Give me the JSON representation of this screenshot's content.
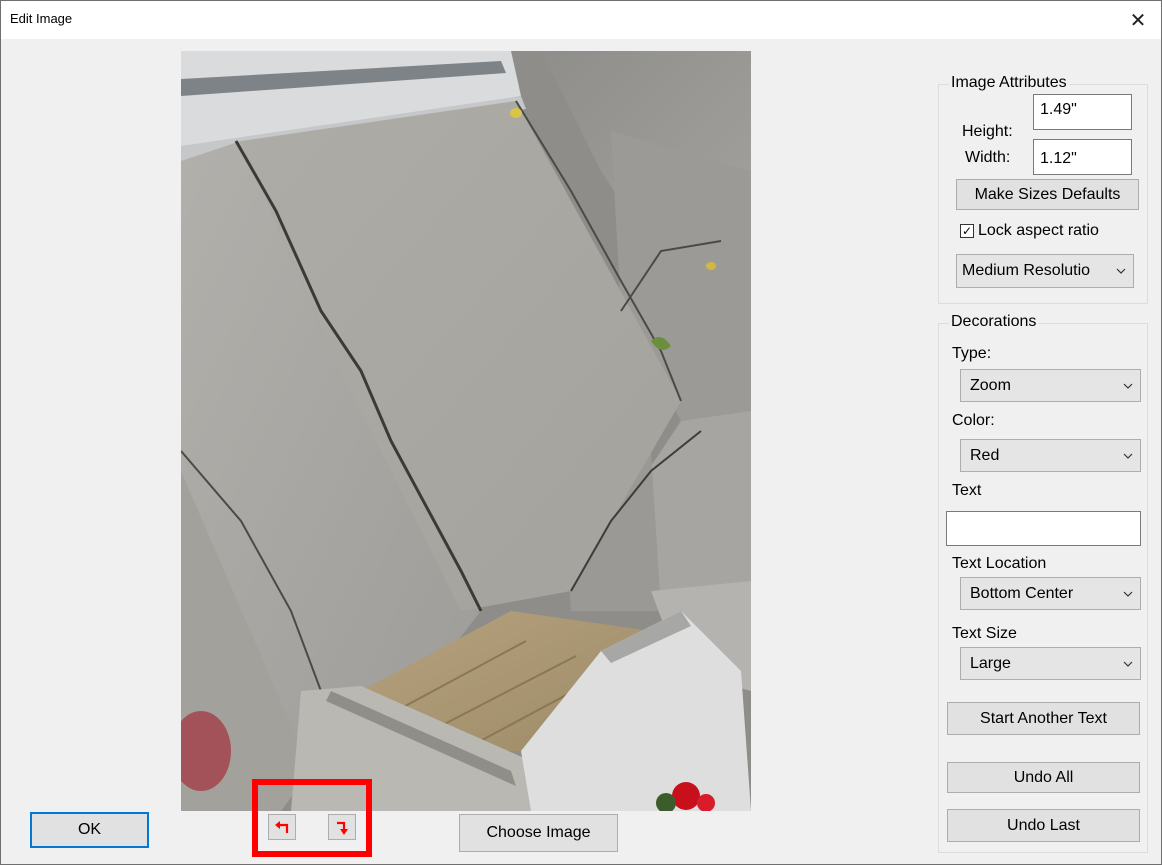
{
  "window": {
    "title": "Edit Image",
    "close_label": "✕"
  },
  "image_attributes": {
    "legend": "Image Attributes",
    "height_label": "Height:",
    "height_value": "1.49\"",
    "width_label": "Width:",
    "width_value": "1.12\"",
    "make_defaults_label": "Make Sizes Defaults",
    "lock_aspect_label": "Lock aspect ratio",
    "lock_aspect_checked": true,
    "resolution_selected": "Medium Resolutio"
  },
  "decorations": {
    "legend": "Decorations",
    "type_label": "Type:",
    "type_selected": "Zoom",
    "color_label": "Color:",
    "color_selected": "Red",
    "text_label": "Text",
    "text_value": "",
    "text_location_label": "Text Location",
    "text_location_selected": "Bottom Center",
    "text_size_label": "Text Size",
    "text_size_selected": "Large",
    "start_another_label": "Start Another Text",
    "undo_all_label": "Undo All",
    "undo_last_label": "Undo Last"
  },
  "footer": {
    "ok_label": "OK",
    "choose_image_label": "Choose Image",
    "rotate_left_icon": "rotate-left-icon",
    "rotate_right_icon": "rotate-right-icon"
  },
  "colors": {
    "highlight": "#ff0000",
    "default_button_border": "#0078d7",
    "rotate_arrow": "#ff0000"
  }
}
